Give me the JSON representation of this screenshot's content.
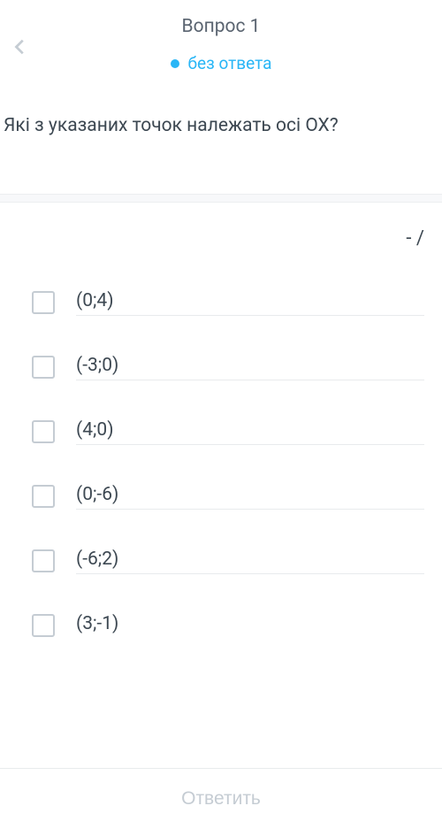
{
  "header": {
    "title": "Вопрос 1",
    "status": "без ответа"
  },
  "question": {
    "text": "Які з указаних точок належать осі ОХ?"
  },
  "score": {
    "display": "-  /"
  },
  "options": [
    {
      "label": "(0;4)"
    },
    {
      "label": "(-3;0)"
    },
    {
      "label": "(4;0)"
    },
    {
      "label": "(0;-6)"
    },
    {
      "label": "(-6;2)"
    },
    {
      "label": "(3;-1)"
    }
  ],
  "footer": {
    "submit": "Ответить"
  }
}
